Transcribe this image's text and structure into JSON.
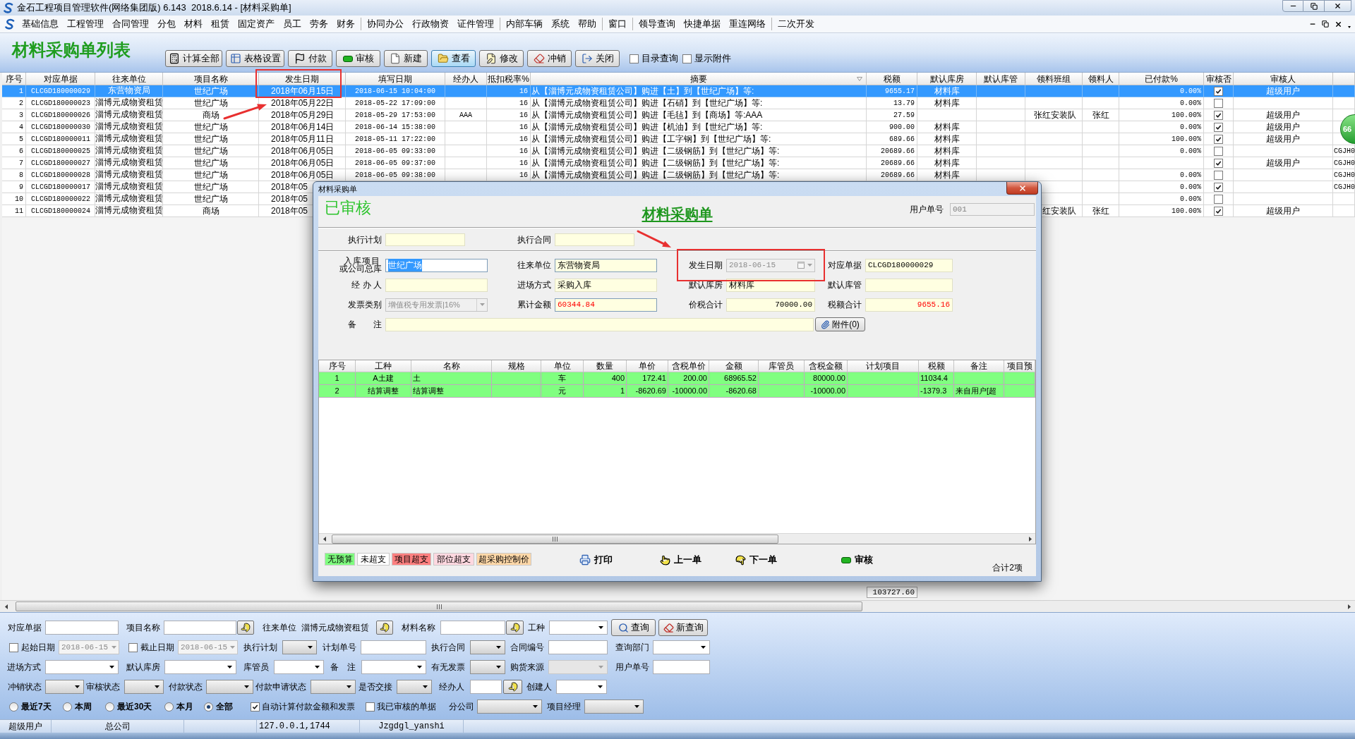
{
  "window": {
    "title": "金石工程项目管理软件(网络集团版) 6.143  2018.6.14 - [材料采购单]"
  },
  "menu": [
    [
      "基础信息",
      "工程管理",
      "合同管理",
      "分包",
      "材料",
      "租赁",
      "固定资产",
      "员工",
      "劳务",
      "财务"
    ],
    [
      "协同办公",
      "行政物资",
      "证件管理"
    ],
    [
      "内部车辆",
      "系统",
      "帮助"
    ],
    [
      "窗口"
    ],
    [
      "领导查询",
      "快捷单据",
      "重连网络"
    ],
    [
      "二次开发"
    ]
  ],
  "page_title": "材料采购单列表",
  "toolbar": {
    "buttons": [
      {
        "label": "计算全部",
        "highlighted": false
      },
      {
        "label": "表格设置",
        "highlighted": false
      },
      {
        "label": "付款",
        "highlighted": false
      },
      {
        "label": "审核",
        "highlighted": false
      },
      {
        "label": "新建",
        "highlighted": false
      },
      {
        "label": "查看",
        "highlighted": true
      },
      {
        "label": "修改",
        "highlighted": false
      },
      {
        "label": "冲销",
        "highlighted": false
      },
      {
        "label": "关闭",
        "highlighted": false
      }
    ],
    "checkboxes": [
      {
        "label": "目录查询",
        "checked": false
      },
      {
        "label": "显示附件",
        "checked": false
      }
    ]
  },
  "table": {
    "columns": [
      {
        "label": "序号",
        "kind": "text"
      },
      {
        "label": "对应单据",
        "kind": "text"
      },
      {
        "label": "往来单位",
        "kind": "text"
      },
      {
        "label": "项目名称",
        "kind": "text"
      },
      {
        "label": "发生日期",
        "kind": "text"
      },
      {
        "label": "填写日期",
        "kind": "text"
      },
      {
        "label": "经办人",
        "kind": "text"
      },
      {
        "label": "抵扣税率%",
        "kind": "text"
      },
      {
        "label": "摘要",
        "kind": "text"
      },
      {
        "label": "税额",
        "kind": "text"
      },
      {
        "label": "默认库房",
        "kind": "text"
      },
      {
        "label": "默认库管",
        "kind": "text"
      },
      {
        "label": "领料班组",
        "kind": "text"
      },
      {
        "label": "领料人",
        "kind": "text"
      },
      {
        "label": "已付款%",
        "kind": "text"
      },
      {
        "label": "审核否",
        "kind": "check"
      },
      {
        "label": "审核人",
        "kind": "text"
      },
      {
        "kind": "text"
      }
    ],
    "rows": [
      {
        "cells": [
          "1",
          "CLCGD180000029",
          "东营物资局",
          "世纪广场",
          "2018年06月15日",
          "2018-06-15 10:04:00",
          null,
          "16",
          "从【淄博元成物资租赁公司】购进【土】到【世纪广场】等:",
          "9655.17",
          "材料库",
          null,
          null,
          null,
          "0.00%",
          null,
          "超级用户",
          null
        ],
        "checked": true,
        "selected": true
      },
      {
        "cells": [
          "2",
          "CLCGD180000023",
          "淄博元成物资租赁",
          "世纪广场",
          "2018年05月22日",
          "2018-05-22 17:09:00",
          null,
          "16",
          "从【淄博元成物资租赁公司】购进【石硝】到【世纪广场】等:",
          "13.79",
          "材料库",
          null,
          null,
          null,
          "0.00%",
          null,
          null,
          null
        ],
        "checked": false,
        "selected": false
      },
      {
        "cells": [
          "3",
          "CLCGD180000026",
          "淄博元成物资租赁",
          "商场",
          "2018年05月29日",
          "2018-05-29 17:53:00",
          "AAA",
          "16",
          "从【淄博元成物资租赁公司】购进【毛毡】到【商场】等:AAA",
          "27.59",
          null,
          null,
          "张红安装队",
          "张红",
          "100.00%",
          null,
          "超级用户",
          null
        ],
        "checked": true,
        "selected": false
      },
      {
        "cells": [
          "4",
          "CLCGD180000030",
          "淄博元成物资租赁",
          "世纪广场",
          "2018年06月14日",
          "2018-06-14 15:38:00",
          null,
          "16",
          "从【淄博元成物资租赁公司】购进【机油】到【世纪广场】等:",
          "900.00",
          "材料库",
          null,
          null,
          null,
          "0.00%",
          null,
          "超级用户",
          null
        ],
        "checked": true,
        "selected": false
      },
      {
        "cells": [
          "5",
          "CLCGD180000011",
          "淄博元成物资租赁",
          "世纪广场",
          "2018年05月11日",
          "2018-05-11 17:22:00",
          null,
          "16",
          "从【淄博元成物资租赁公司】购进【工字钢】到【世纪广场】等:",
          "689.66",
          "材料库",
          null,
          null,
          null,
          "100.00%",
          null,
          "超级用户",
          null
        ],
        "checked": true,
        "selected": false
      },
      {
        "cells": [
          "6",
          "CLCGD180000025",
          "淄博元成物资租赁",
          "世纪广场",
          "2018年06月05日",
          "2018-06-05 09:33:00",
          null,
          "16",
          "从【淄博元成物资租赁公司】购进【二级钢筋】到【世纪广场】等:",
          "20689.66",
          "材料库",
          null,
          null,
          null,
          "0.00%",
          null,
          null,
          "CGJH0"
        ],
        "checked": false,
        "selected": false
      },
      {
        "cells": [
          "7",
          "CLCGD180000027",
          "淄博元成物资租赁",
          "世纪广场",
          "2018年06月05日",
          "2018-06-05 09:37:00",
          null,
          "16",
          "从【淄博元成物资租赁公司】购进【二级钢筋】到【世纪广场】等:",
          "20689.66",
          "材料库",
          null,
          null,
          null,
          null,
          null,
          "超级用户",
          "CGJH0"
        ],
        "checked": true,
        "selected": false
      },
      {
        "cells": [
          "8",
          "CLCGD180000028",
          "淄博元成物资租赁",
          "世纪广场",
          "2018年06月05日",
          "2018-06-05 09:38:00",
          null,
          "16",
          "从【淄博元成物资租赁公司】购进【二级钢筋】到【世纪广场】等:",
          "20689.66",
          "材料库",
          null,
          null,
          null,
          "0.00%",
          null,
          null,
          "CGJH0"
        ],
        "checked": false,
        "selected": false
      },
      {
        "cells": [
          "9",
          "CLCGD180000017",
          "淄博元成物资租赁",
          "世纪广场",
          "2018年05",
          null,
          null,
          null,
          null,
          null,
          null,
          null,
          null,
          null,
          "0.00%",
          null,
          null,
          "CGJH0"
        ],
        "checked": true,
        "selected": false
      },
      {
        "cells": [
          "10",
          "CLCGD180000022",
          "淄博元成物资租赁",
          "世纪广场",
          "2018年05",
          null,
          null,
          null,
          null,
          null,
          null,
          null,
          null,
          null,
          "0.00%",
          null,
          null,
          null
        ],
        "checked": false,
        "selected": false
      },
      {
        "cells": [
          "11",
          "CLCGD180000024",
          "淄博元成物资租赁",
          "商场",
          "2018年05",
          null,
          null,
          null,
          null,
          null,
          null,
          null,
          "红安装队",
          "张红",
          "100.00%",
          null,
          "超级用户",
          null
        ],
        "checked": true,
        "selected": false
      }
    ],
    "total": "103727.60"
  },
  "badge": "66",
  "dialog": {
    "title": "材料采购单",
    "status": "已审核",
    "heading": "材料采购单",
    "user_no": {
      "label": "用户单号",
      "value": "001",
      "disabled": true
    },
    "plan": [
      {
        "label": "执行计划"
      },
      {
        "label": "执行合同"
      }
    ],
    "form": [
      [
        {
          "label_lines": [
            "入库项目",
            "或公司总库"
          ],
          "value": "世纪广场",
          "kind": "input",
          "disabled": false,
          "editable": true,
          "focused": true
        },
        {
          "label": "往来单位",
          "value": "东营物资局",
          "kind": "input",
          "disabled": false,
          "editable": true,
          "focused": false
        },
        {
          "label": "发生日期",
          "value": "2018-06-15",
          "kind": "date",
          "disabled": true
        },
        {
          "label": "对应单据",
          "value": "CLCGD180000029",
          "kind": "input",
          "disabled": false,
          "editable": false,
          "focused": false
        }
      ],
      [
        {
          "label": "经 办 人",
          "kind": "input",
          "disabled": false,
          "editable": false,
          "focused": false
        },
        {
          "label": "进场方式",
          "value": "采购入库",
          "kind": "input",
          "disabled": false,
          "editable": false,
          "focused": false
        },
        {
          "label": "默认库房",
          "value": "材料库",
          "kind": "input",
          "disabled": false,
          "editable": false,
          "focused": false
        },
        {
          "label": "默认库管",
          "kind": "input",
          "disabled": false,
          "editable": false,
          "focused": false
        }
      ],
      [
        {
          "label": "发票类别",
          "value": "增值税专用发票|16%",
          "kind": "select",
          "disabled": true
        },
        {
          "label": "累计金额",
          "value": "60344.84",
          "kind": "input",
          "color": "#ff0000",
          "disabled": false,
          "editable": true,
          "focused": false
        },
        {
          "label": "价税合计",
          "value": "70000.00",
          "kind": "input",
          "disabled": false,
          "editable": false,
          "focused": false
        },
        {
          "label": "税额合计",
          "value": "9655.16",
          "kind": "input",
          "color": "#ff0000",
          "disabled": false,
          "editable": false,
          "focused": false
        }
      ]
    ],
    "remark": {
      "label": "备　　注"
    },
    "attach_button": "附件(0)",
    "grid": {
      "columns": [
        "序号",
        "工种",
        "名称",
        "规格",
        "单位",
        "数量",
        "单价",
        "含税单价",
        "金额",
        "库管员",
        "含税金额",
        "计划项目",
        "税额",
        "备注",
        "项目预"
      ],
      "rows": [
        {
          "color": "#80ff80",
          "cells": [
            "1",
            "A土建",
            "土",
            null,
            "车",
            "400",
            "172.41",
            "200.00",
            "68965.52",
            null,
            "80000.00",
            null,
            "11034.4",
            null,
            null
          ]
        },
        {
          "color": "#80ff80",
          "cells": [
            "2",
            "结算调整",
            "结算调整",
            null,
            "元",
            "1",
            "-8620.69",
            "-10000.00",
            "-8620.68",
            null,
            "-10000.00",
            null,
            "-1379.3",
            "来自用户[超",
            null
          ]
        }
      ]
    },
    "legend": [
      {
        "label": "无预算",
        "color": "#80ff80"
      },
      {
        "label": "未超支",
        "color": "#ffffff"
      },
      {
        "label": "项目超支",
        "color": "#ff8080"
      },
      {
        "label": "部位超支",
        "color": "#ffd8e0"
      },
      {
        "label": "超采购控制价",
        "color": "#ffd8a8"
      }
    ],
    "actions": [
      "打印",
      "上一单",
      "下一单",
      "审核"
    ],
    "count": "合计2项"
  },
  "filter": {
    "lines": [
      {
        "items": [
          {
            "kind": "input",
            "label": "对应单据"
          },
          {
            "kind": "input",
            "label": "项目名称",
            "lookup": true
          },
          {
            "kind": "text",
            "label": "往来单位",
            "value": "淄博元成物资租赁",
            "lookup": true
          },
          {
            "kind": "input",
            "label": "材料名称",
            "lookup": true
          },
          {
            "kind": "select",
            "label": "工种"
          },
          {
            "kind": "button",
            "label": "查询"
          },
          {
            "kind": "button",
            "label": "新查询"
          }
        ]
      },
      {
        "items": [
          {
            "kind": "date",
            "label": "起始日期",
            "value": "2018-06-15",
            "checked": false
          },
          {
            "kind": "date",
            "label": "截止日期",
            "value": "2018-06-15",
            "checked": false
          },
          {
            "kind": "combo",
            "label": "执行计划",
            "disabled": false
          },
          {
            "kind": "input",
            "label": "计划单号"
          },
          {
            "kind": "combo",
            "label": "执行合同",
            "disabled": false
          },
          {
            "kind": "input",
            "label": "合同编号"
          },
          {
            "kind": "select",
            "label": "查询部门"
          }
        ]
      },
      {
        "items": [
          {
            "kind": "select",
            "label": "进场方式"
          },
          {
            "kind": "select",
            "label": "默认库房"
          },
          {
            "kind": "select",
            "label": "库管员"
          },
          {
            "kind": "select",
            "label": "备　注"
          },
          {
            "kind": "combo",
            "label": "有无发票",
            "disabled": false
          },
          {
            "kind": "combo",
            "label": "购货来源",
            "disabled": true
          },
          {
            "kind": "input",
            "label": "用户单号"
          }
        ]
      },
      {
        "items": [
          {
            "kind": "combo",
            "label": "冲销状态",
            "disabled": false
          },
          {
            "kind": "combo",
            "label": "审核状态",
            "disabled": false
          },
          {
            "kind": "combo",
            "label": "付款状态",
            "disabled": false
          },
          {
            "kind": "combo",
            "label": "付款申请状态",
            "disabled": false
          },
          {
            "kind": "combo",
            "label": "是否交接",
            "disabled": false
          },
          {
            "kind": "input",
            "label": "经办人",
            "lookup": true
          },
          {
            "kind": "select",
            "label": "创建人"
          }
        ]
      },
      {
        "items": [
          {
            "kind": "radio_group",
            "options": [
              {
                "label": "最近7天",
                "selected": false
              },
              {
                "label": "本周",
                "selected": false
              },
              {
                "label": "最近30天",
                "selected": false
              },
              {
                "label": "本月",
                "selected": false
              },
              {
                "label": "全部",
                "selected": true
              }
            ]
          },
          {
            "kind": "checkbox",
            "label": "自动计算付款金额和发票",
            "checked": true
          },
          {
            "kind": "checkbox",
            "label": "我已审核的单据",
            "checked": false
          },
          {
            "kind": "combo",
            "label": "分公司",
            "disabled": false
          },
          {
            "kind": "combo",
            "label": "项目经理",
            "disabled": false
          }
        ]
      }
    ]
  },
  "status_bar": [
    "超级用户",
    "总公司",
    "127.0.0.1,1744",
    "Jzgdgl_yanshi"
  ]
}
